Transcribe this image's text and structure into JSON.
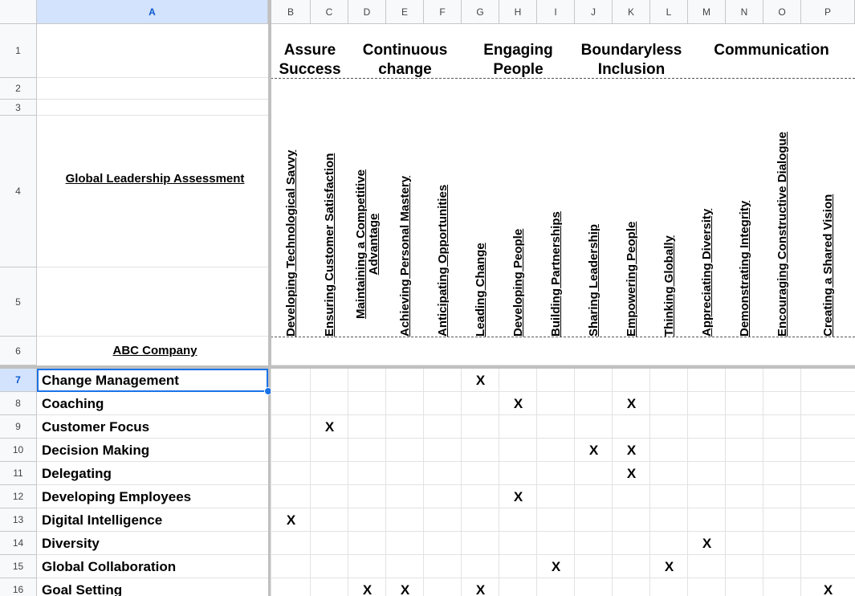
{
  "columns": [
    "A",
    "B",
    "C",
    "D",
    "E",
    "F",
    "G",
    "H",
    "I",
    "J",
    "K",
    "L",
    "M",
    "N",
    "O",
    "P"
  ],
  "selected_column": "A",
  "header_rows": [
    "1",
    "2",
    "3",
    "4",
    "5",
    "6"
  ],
  "title": "Global Leadership Assessment",
  "company": "ABC Company",
  "groups": [
    {
      "label": "Assure\nSuccess"
    },
    {
      "label": "Continuous\nchange"
    },
    {
      "label": "Engaging\nPeople"
    },
    {
      "label": "Boundaryless\nInclusion"
    },
    {
      "label": "Communication"
    }
  ],
  "competencies": [
    "Developing Technological Savvy",
    "Ensuring Customer Satisfaction",
    "Maintaining a Competitive\nAdvantage",
    "Achieving Personal Mastery",
    "Anticipating Opportunities",
    "Leading Change",
    "Developing People",
    "Building Partnerships",
    "Sharing Leadership",
    "Empowering People",
    "Thinking Globally",
    "Appreciating Diversity",
    "Demonstrating Integrity",
    "Encouraging Constructive Dialogue",
    "Creating a Shared Vision"
  ],
  "mark_symbol": "X",
  "rows": [
    {
      "num": "7",
      "label": "Change Management",
      "marks": [
        "G"
      ],
      "selected": true
    },
    {
      "num": "8",
      "label": "Coaching",
      "marks": [
        "H",
        "K"
      ]
    },
    {
      "num": "9",
      "label": "Customer Focus",
      "marks": [
        "C"
      ]
    },
    {
      "num": "10",
      "label": "Decision Making",
      "marks": [
        "J",
        "K"
      ]
    },
    {
      "num": "11",
      "label": "Delegating",
      "marks": [
        "K"
      ]
    },
    {
      "num": "12",
      "label": "Developing Employees",
      "marks": [
        "H"
      ]
    },
    {
      "num": "13",
      "label": "Digital Intelligence",
      "marks": [
        "B"
      ]
    },
    {
      "num": "14",
      "label": "Diversity",
      "marks": [
        "M"
      ]
    },
    {
      "num": "15",
      "label": "Global Collaboration",
      "marks": [
        "I",
        "L"
      ]
    },
    {
      "num": "16",
      "label": "Goal Setting",
      "marks": [
        "D",
        "E",
        "G",
        "P"
      ]
    }
  ],
  "colors": {
    "header_bg": "#f8f9fa",
    "selection": "#1a73e8",
    "selected_header_bg": "#d3e3fd",
    "grid": "#e2e2e2",
    "freeze_bar": "#c0c0c0"
  }
}
